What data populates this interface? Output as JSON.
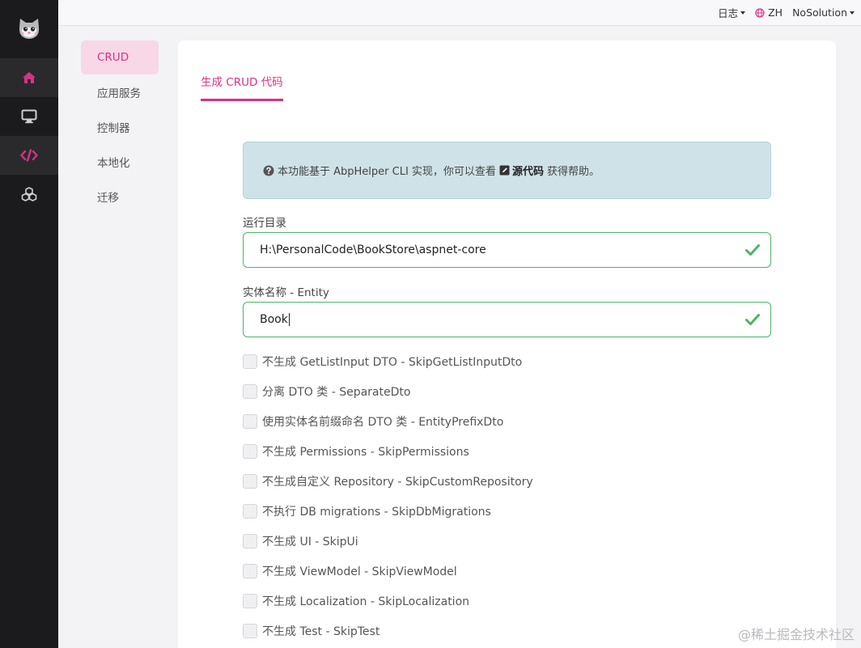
{
  "topbar": {
    "log": "日志",
    "language": "ZH",
    "solution": "NoSolution"
  },
  "subnav": {
    "items": [
      "CRUD",
      "应用服务",
      "控制器",
      "本地化",
      "迁移"
    ]
  },
  "tab": {
    "label": "生成 CRUD 代码"
  },
  "alert": {
    "text_before": "本功能基于 AbpHelper CLI 实现，你可以查看",
    "link": "源代码",
    "text_after": "获得帮助。"
  },
  "form": {
    "dir_label": "运行目录",
    "dir_value": "H:\\PersonalCode\\BookStore\\aspnet-core",
    "entity_label": "实体名称 - Entity",
    "entity_value": "Book"
  },
  "options": [
    "不生成 GetListInput DTO - SkipGetListInputDto",
    "分离 DTO 类 - SeparateDto",
    "使用实体名前缀命名 DTO 类 - EntityPrefixDto",
    "不生成 Permissions - SkipPermissions",
    "不生成自定义 Repository - SkipCustomRepository",
    "不执行 DB migrations - SkipDbMigrations",
    "不生成 UI - SkipUi",
    "不生成 ViewModel - SkipViewModel",
    "不生成 Localization - SkipLocalization",
    "不生成 Test - SkipTest"
  ],
  "watermark": "@稀土掘金技术社区",
  "colors": {
    "accent": "#d63384",
    "success": "#4cb46b",
    "rail": "#1b1b1d"
  }
}
